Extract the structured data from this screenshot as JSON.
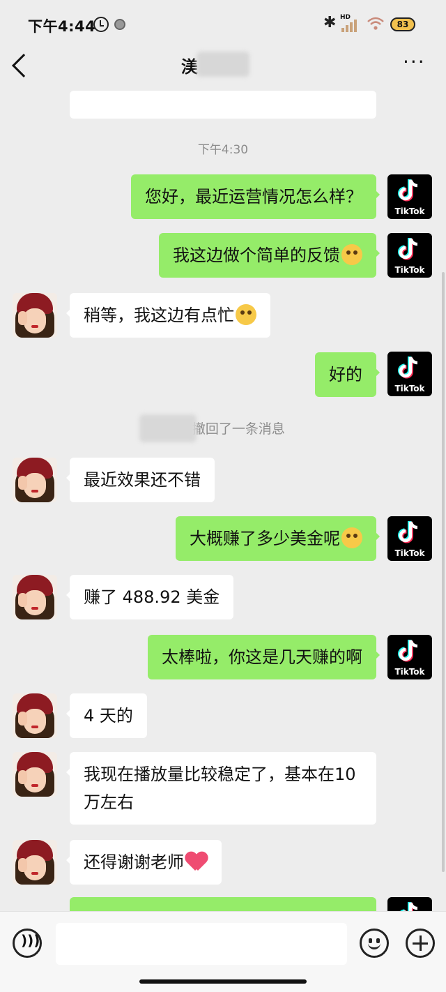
{
  "status_bar": {
    "time": "下午4:44",
    "network": "HD",
    "battery": "83"
  },
  "header": {
    "title": "渼",
    "back_icon": "chevron-left-icon",
    "more_icon": "more-icon"
  },
  "conversation": {
    "timestamp": "下午4:30",
    "recall_notice": "“渼          ”撤回了一条消息",
    "messages": [
      {
        "sender": "me",
        "text": "您好，最近运营情况怎么样？"
      },
      {
        "sender": "me",
        "text": "我这边做个简单的反馈",
        "emoji": "smirk-emoji"
      },
      {
        "sender": "them",
        "text": "稍等，我这边有点忙",
        "emoji": "tears-emoji"
      },
      {
        "sender": "me",
        "text": "好的"
      },
      {
        "sender": "them",
        "text": "最近效果还不错"
      },
      {
        "sender": "me",
        "text": "大概赚了多少美金呢",
        "emoji": "wink-emoji"
      },
      {
        "sender": "them",
        "text": "赚了 488.92 美金"
      },
      {
        "sender": "me",
        "text": "太棒啦，你这是几天赚的啊"
      },
      {
        "sender": "them",
        "text": "4 天的"
      },
      {
        "sender": "them",
        "text": "我现在播放量比较稳定了，基本在10 万左右"
      },
      {
        "sender": "them",
        "text": "还得谢谢老师",
        "emoji": "heart-emoji"
      }
    ]
  },
  "avatars": {
    "me_label": "TikTok"
  },
  "input_bar": {
    "placeholder": "",
    "voice_icon": "voice-icon",
    "emoji_icon": "emoji-icon",
    "plus_icon": "plus-icon"
  },
  "colors": {
    "background": "#ededed",
    "my_bubble": "#95ec69",
    "their_bubble": "#ffffff",
    "tiktok_bg": "#000000",
    "heart": "#ef4c72"
  }
}
